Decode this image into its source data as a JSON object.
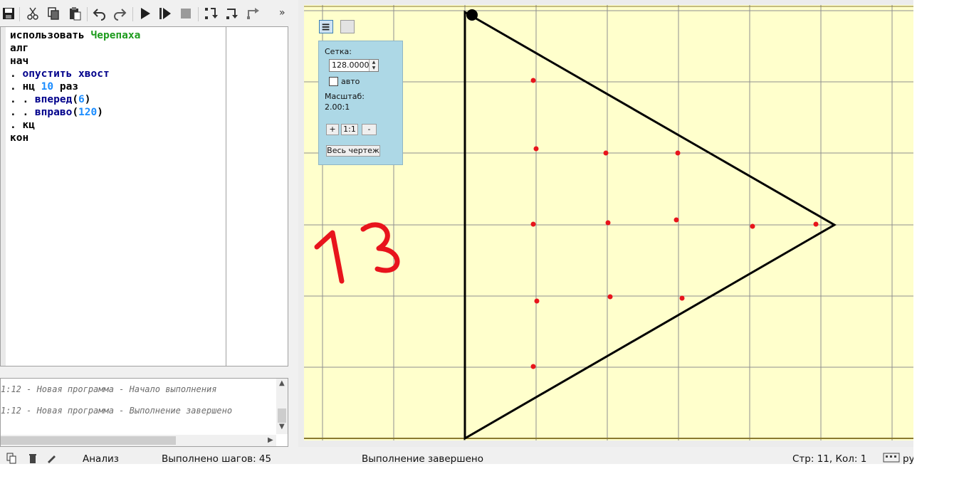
{
  "toolbar": {
    "buttons": [
      "save-icon",
      "cut-icon",
      "copy-icon",
      "paste-icon",
      "undo-icon",
      "redo-icon",
      "run-icon",
      "run-step-icon",
      "stop-icon",
      "step-in-icon",
      "step-over-icon",
      "step-out-icon"
    ],
    "more_label": "»"
  },
  "editor": {
    "lines": [
      {
        "indent": "",
        "tokens": [
          [
            "использовать ",
            "plain"
          ],
          [
            "Черепаха",
            "green"
          ]
        ]
      },
      {
        "indent": "",
        "tokens": [
          [
            "алг",
            "plain"
          ]
        ]
      },
      {
        "indent": "",
        "tokens": [
          [
            "нач",
            "plain"
          ]
        ]
      },
      {
        "indent": ". ",
        "tokens": [
          [
            "опустить хвост",
            "kw"
          ]
        ]
      },
      {
        "indent": ". ",
        "tokens": [
          [
            "нц ",
            "plain"
          ],
          [
            "10",
            "num"
          ],
          [
            " раз",
            "plain"
          ]
        ]
      },
      {
        "indent": ". . ",
        "tokens": [
          [
            "вперед",
            "kw"
          ],
          [
            "(",
            "plain"
          ],
          [
            "6",
            "num"
          ],
          [
            ")",
            "plain"
          ]
        ]
      },
      {
        "indent": ". . ",
        "tokens": [
          [
            "вправо",
            "kw"
          ],
          [
            "(",
            "plain"
          ],
          [
            "120",
            "num"
          ],
          [
            ")",
            "plain"
          ]
        ]
      },
      {
        "indent": ". ",
        "tokens": [
          [
            "кц",
            "plain"
          ]
        ]
      },
      {
        "indent": "",
        "tokens": [
          [
            "кон",
            "plain"
          ]
        ]
      }
    ]
  },
  "console": {
    "lines": [
      "1:12 - Новая программа - Начало выполнения",
      "1:12 - Новая программа - Выполнение завершено"
    ]
  },
  "status": {
    "analysis": "Анализ",
    "steps": "Выполнено шагов: 45",
    "state": "Выполнение завершено",
    "position": "Стр: 11, Кол: 1",
    "lang": "ру"
  },
  "grid_panel": {
    "grid_label": "Сетка:",
    "grid_value": "128.0000",
    "auto_label": "авто",
    "auto_checked": false,
    "scale_label": "Масштаб:",
    "scale_value": "2.00:1",
    "zoom_in": "+",
    "zoom_reset": "1:1",
    "zoom_out": "-",
    "fit_all": "Весь чертеж"
  },
  "annotation": {
    "text": "13",
    "color": "#e8141c"
  },
  "colors": {
    "canvas_bg": "#ffffcc",
    "grid": "#8f8f8f",
    "turtle_line": "#000000",
    "dots": "#e8141c"
  }
}
